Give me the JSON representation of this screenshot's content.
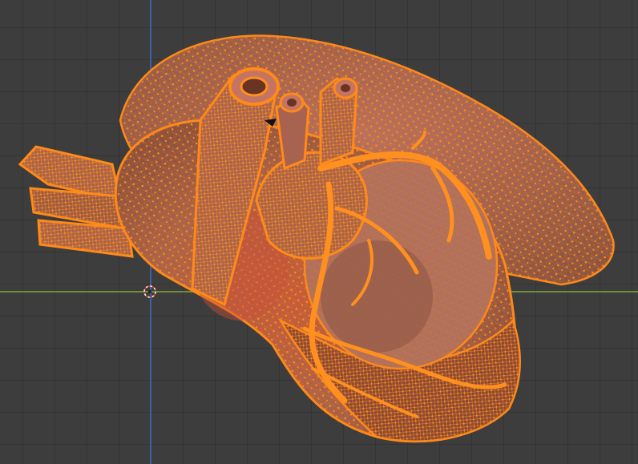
{
  "viewport": {
    "object": "heart-mesh",
    "mode": "edit",
    "selection": "all"
  },
  "colors": {
    "background": "#3d3d3d",
    "grid_line": "#343434",
    "x_axis": "#6e8e36",
    "z_axis": "#3f5fa0",
    "mesh_fill": "#b06a52",
    "mesh_shadow": "#8a4a38",
    "wire": "#e07d10",
    "vertex": "#ff8a1a",
    "highlight": "#d05a40"
  },
  "icons": {
    "cursor": "3d-cursor-icon"
  }
}
